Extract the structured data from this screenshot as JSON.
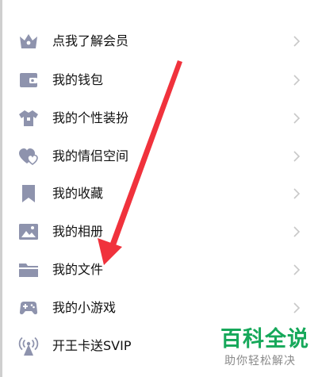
{
  "menu": {
    "items": [
      {
        "label": "点我了解会员",
        "icon": "crown-icon"
      },
      {
        "label": "我的钱包",
        "icon": "wallet-icon"
      },
      {
        "label": "我的个性装扮",
        "icon": "tshirt-icon"
      },
      {
        "label": "我的情侣空间",
        "icon": "hearts-icon"
      },
      {
        "label": "我的收藏",
        "icon": "bookmark-icon"
      },
      {
        "label": "我的相册",
        "icon": "photo-icon"
      },
      {
        "label": "我的文件",
        "icon": "folder-icon"
      },
      {
        "label": "我的小游戏",
        "icon": "gamepad-icon"
      },
      {
        "label": "开王卡送SVIP",
        "icon": "antenna-icon"
      }
    ]
  },
  "watermark": {
    "title": "百科全说",
    "subtitle": "助你轻松解决"
  },
  "colors": {
    "icon": "#8e93ad",
    "arrow": "#f0323c",
    "chevron": "#c8c8c8",
    "watermark": "#16a85a"
  }
}
